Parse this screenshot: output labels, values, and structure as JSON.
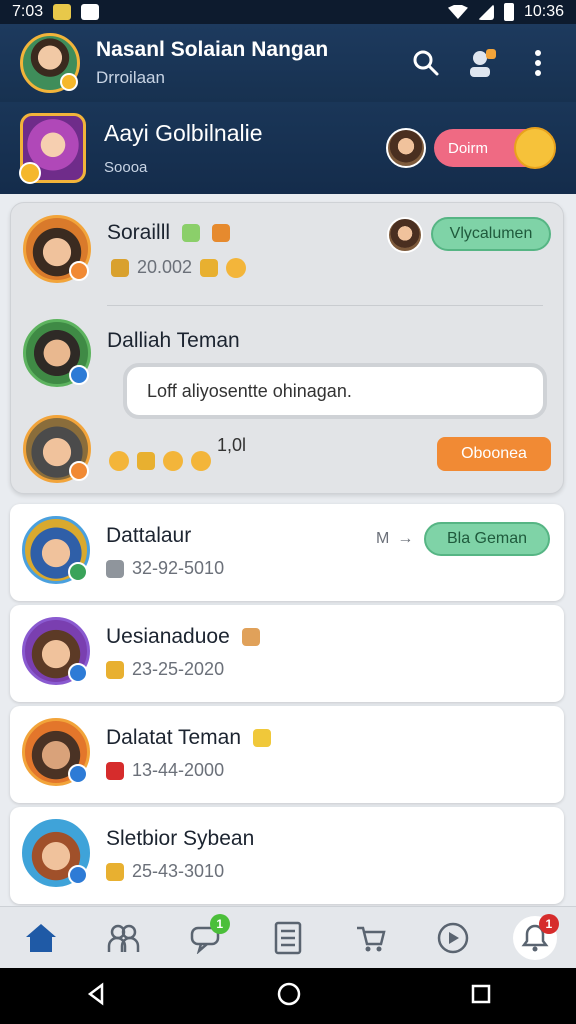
{
  "status_bar": {
    "time": "7:03",
    "clock": "10:36"
  },
  "header": {
    "title": "Nasanl Solaian Nangan",
    "subtitle": "Drroilaan"
  },
  "featured": {
    "title": "Aayi Golbilnalie",
    "subtitle": "Soooa",
    "join_label": "Doirm"
  },
  "group": {
    "item1": {
      "name": "Sorailll",
      "meta": "20.002",
      "pill": "Vlycalumen"
    },
    "item2": {
      "name": "Dalliah Teman",
      "message": "Loff aliyosentte ohinagan."
    },
    "item3": {
      "count": "1,0l",
      "pill": "Oboonea"
    }
  },
  "list": [
    {
      "name": "Dattalaur",
      "meta": "32-92-5010",
      "pill": "Bla Geman",
      "side": "M"
    },
    {
      "name": "Uesianaduoe",
      "meta": "23-25-2020"
    },
    {
      "name": "Dalatat Teman",
      "meta": "13-44-2000"
    },
    {
      "name": "Sletbior Sybean",
      "meta": "25-43-3010"
    }
  ],
  "nav_badges": {
    "chat": "1",
    "alerts": "1"
  },
  "colors": {
    "header": "#1d3a5e",
    "accent_green": "#7fd3a7",
    "accent_orange": "#f18a34",
    "accent_pink": "#ef6a83"
  }
}
